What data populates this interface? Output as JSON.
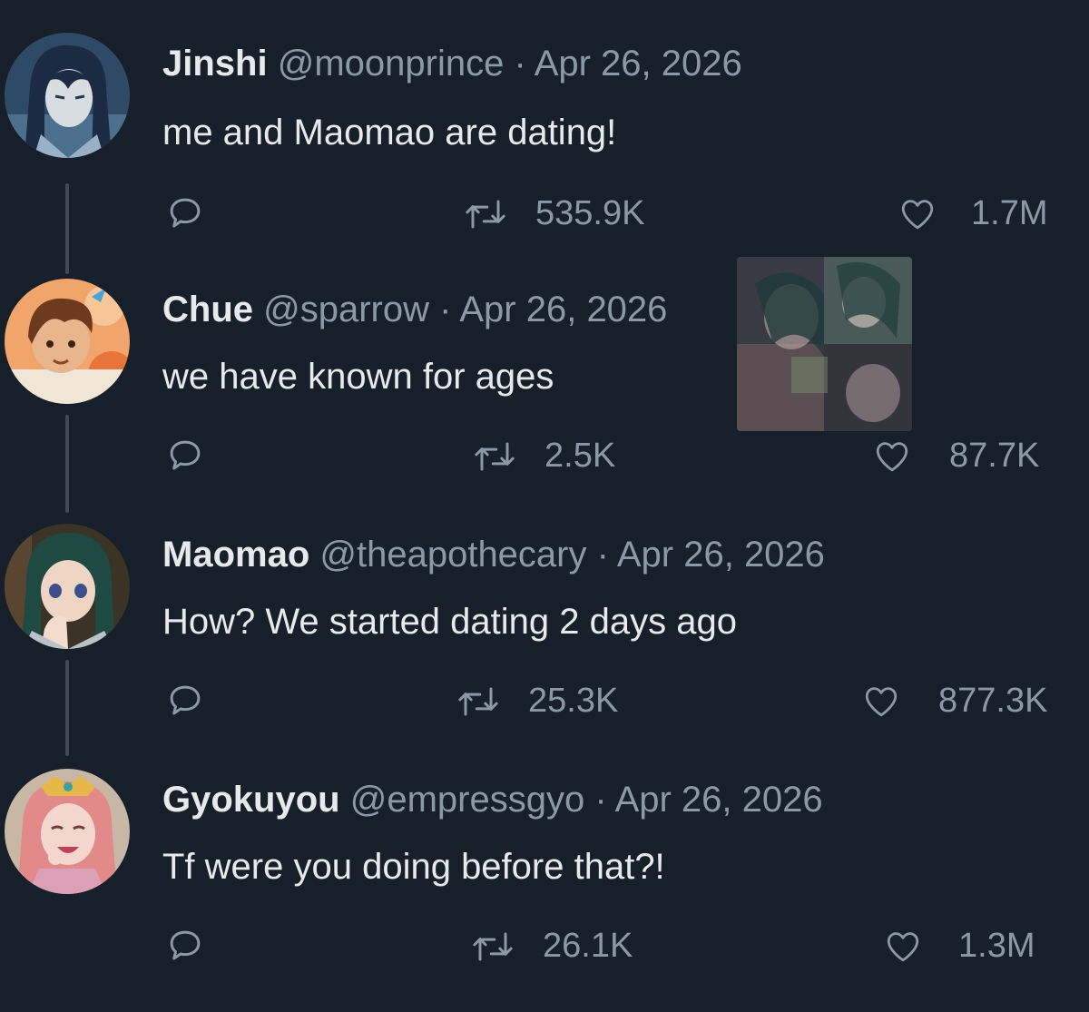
{
  "tweets": [
    {
      "name": "Jinshi",
      "handle": "@moonprince",
      "separator": "·",
      "date": "Apr 26, 2026",
      "text": "me and Maomao are dating!",
      "retweets": "535.9K",
      "likes": "1.7M",
      "avatar_colors": {
        "bg": "#2f4a66",
        "hair": "#1d2a44",
        "skin": "#d8dde2"
      }
    },
    {
      "name": "Chue",
      "handle": "@sparrow",
      "separator": "·",
      "date": "Apr 26, 2026",
      "text": "we have known for ages",
      "retweets": "2.5K",
      "likes": "87.7K",
      "avatar_colors": {
        "bg": "#f2a56a",
        "hair": "#6b3a1f",
        "skin": "#e9b58c"
      }
    },
    {
      "name": "Maomao",
      "handle": "@theapothecary",
      "separator": "·",
      "date": "Apr 26, 2026",
      "text": "How? We started dating 2 days ago",
      "retweets": "25.3K",
      "likes": "877.3K",
      "avatar_colors": {
        "bg": "#3a3326",
        "hair": "#1f4a44",
        "skin": "#efd6c4"
      }
    },
    {
      "name": "Gyokuyou",
      "handle": "@empressgyo",
      "separator": "·",
      "date": "Apr 26, 2026",
      "text": "Tf were you doing before that?!",
      "retweets": "26.1K",
      "likes": "1.3M",
      "avatar_colors": {
        "bg": "#c9b7a6",
        "hair": "#e28a8a",
        "skin": "#f3d6cd"
      }
    }
  ],
  "icons": {
    "reply": "reply-icon",
    "retweet": "retweet-icon",
    "like": "heart-icon"
  },
  "colors": {
    "background": "#17202a",
    "text": "#e7e9ea",
    "muted": "#8b98a5",
    "thread_line": "#3f4a55"
  }
}
